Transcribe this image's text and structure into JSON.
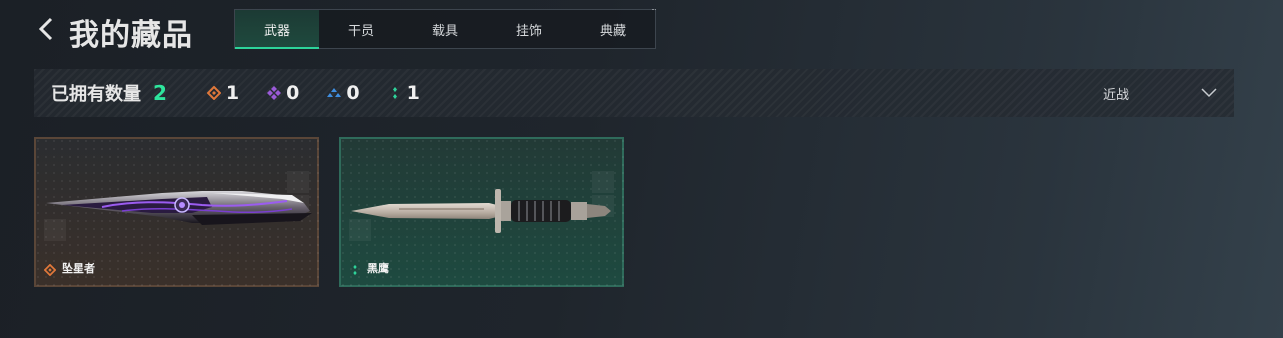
{
  "header": {
    "title": "我的藏品",
    "tabs": [
      {
        "label": "武器",
        "active": true
      },
      {
        "label": "干员",
        "active": false
      },
      {
        "label": "载具",
        "active": false
      },
      {
        "label": "挂饰",
        "active": false
      },
      {
        "label": "典藏",
        "active": false
      }
    ]
  },
  "stats": {
    "owned_label": "已拥有数量",
    "owned_count": "2",
    "rarities": [
      {
        "icon": "orange-diamond-icon",
        "color": "#e0783a",
        "count": "1"
      },
      {
        "icon": "purple-diamond-icon",
        "color": "#9a5ad8",
        "count": "0"
      },
      {
        "icon": "blue-triangle-icon",
        "color": "#3f8ee0",
        "count": "0"
      },
      {
        "icon": "green-dots-icon",
        "color": "#2ed39a",
        "count": "1"
      }
    ],
    "filter_label": "近战"
  },
  "cards": [
    {
      "name": "坠星者",
      "rarity_color": "#e0783a",
      "icon": "orange-diamond-icon",
      "weapon": "purple-blade-knife"
    },
    {
      "name": "黑鹰",
      "rarity_color": "#2ed39a",
      "icon": "green-dots-icon",
      "weapon": "combat-knife"
    }
  ],
  "colors": {
    "accent": "#2ee59d"
  }
}
